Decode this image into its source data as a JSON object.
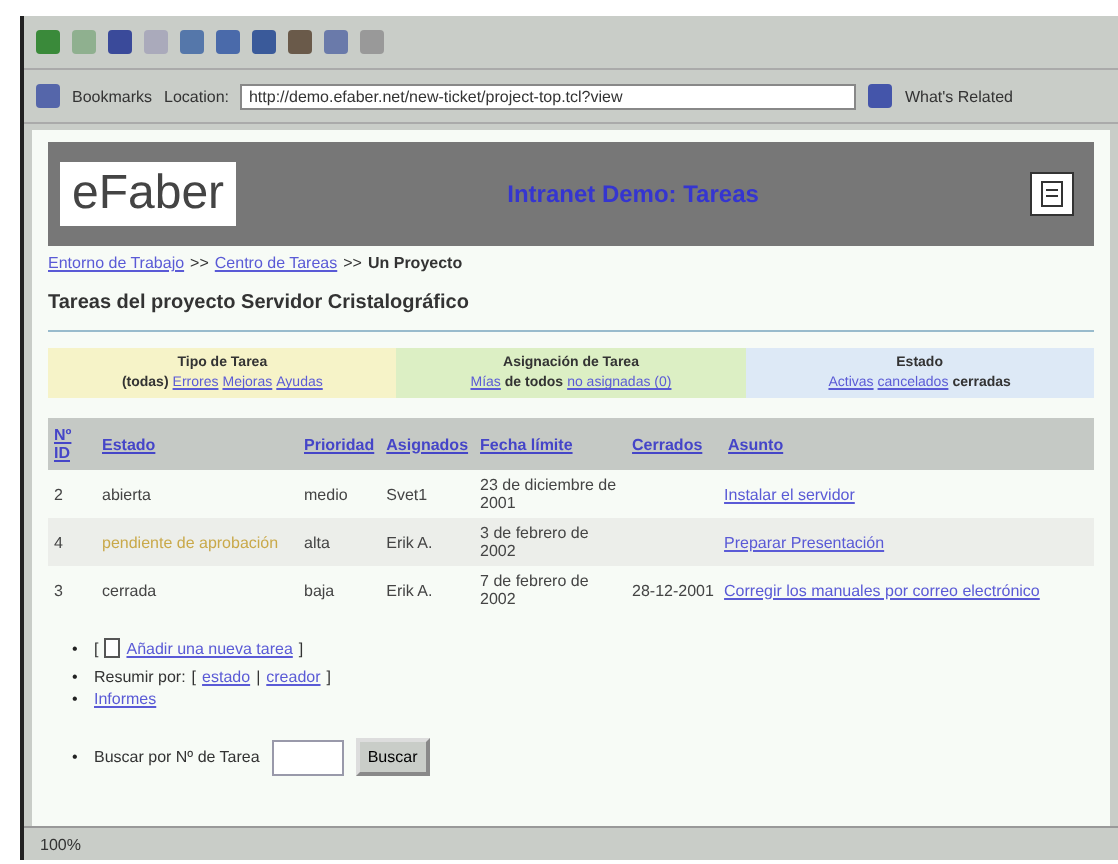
{
  "toolbar": {
    "bookmarks": "Bookmarks",
    "location_label": "Location:",
    "url": "http://demo.efaber.net/new-ticket/project-top.tcl?view",
    "related": "What's Related"
  },
  "header": {
    "logo": "eFaber",
    "title": "Intranet Demo: Tareas"
  },
  "breadcrumb": [
    {
      "label": "Entorno de Trabajo",
      "link": true
    },
    {
      "label": ">>",
      "link": false
    },
    {
      "label": "Centro de Tareas",
      "link": true
    },
    {
      "label": ">>",
      "link": false
    },
    {
      "label": "Un Proyecto",
      "link": false
    }
  ],
  "heading": "Tareas del proyecto Servidor Cristalográfico",
  "filters": [
    {
      "title": "Tipo de Tarea",
      "color": "#f6f3c8",
      "options": [
        {
          "label": "(todas)",
          "selected": true
        },
        {
          "label": "Errores",
          "selected": false
        },
        {
          "label": "Mejoras",
          "selected": false
        },
        {
          "label": "Ayudas",
          "selected": false
        }
      ]
    },
    {
      "title": "Asignación de Tarea",
      "color": "#dcefc4",
      "options": [
        {
          "label": "Mías",
          "selected": false
        },
        {
          "label": "de todos",
          "selected": true
        },
        {
          "label": "no asignadas (0)",
          "selected": false
        }
      ]
    },
    {
      "title": "Estado",
      "color": "#dde9f6",
      "options": [
        {
          "label": "Activas",
          "selected": false
        },
        {
          "label": "cancelados",
          "selected": false
        },
        {
          "label": "cerradas",
          "selected": true
        }
      ]
    }
  ],
  "table": {
    "columns": [
      "Nº ID",
      "Estado",
      "Prioridad",
      "Asignados",
      "Fecha límite",
      "Cerrados",
      "Asunto"
    ],
    "rows": [
      {
        "id": "2",
        "status": "abierta",
        "pending": false,
        "priority": "medio",
        "assignee": "Svet1",
        "due": "23 de diciembre de 2001",
        "closed": "",
        "subject": "Instalar el servidor"
      },
      {
        "id": "4",
        "status": "pendiente de aprobación",
        "pending": true,
        "priority": "alta",
        "assignee": "Erik A.",
        "due": "3 de febrero de 2002",
        "closed": "",
        "subject": "Preparar Presentación"
      },
      {
        "id": "3",
        "status": "cerrada",
        "pending": false,
        "priority": "baja",
        "assignee": "Erik A.",
        "due": "7 de febrero de 2002",
        "closed": "28-12-2001",
        "subject": "Corregir los manuales por correo electrónico"
      }
    ]
  },
  "actions": {
    "bullet": "•",
    "add": {
      "open": "[",
      "link": "Añadir una nueva tarea",
      "close": "]"
    },
    "summary": {
      "label": "Resumir por:",
      "open": "[",
      "links": [
        "estado",
        "creador"
      ],
      "sep": "|",
      "close": "]"
    },
    "reports": "Informes",
    "search": {
      "label": "Buscar por Nº de Tarea",
      "button": "Buscar"
    }
  },
  "status_bar": {
    "zoom": "100%"
  }
}
